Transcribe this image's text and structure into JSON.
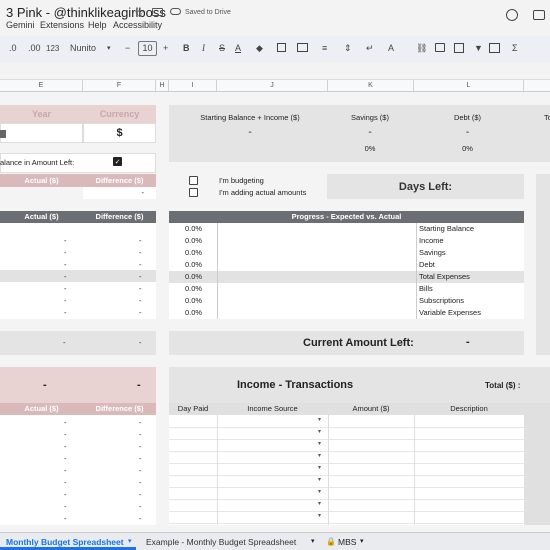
{
  "window": {
    "doc_title": "3 Pink - @thinklikeagirlboss",
    "saved_status": "Saved to Drive",
    "menu": [
      "Gemini",
      "Extensions",
      "Help",
      "Accessibility"
    ]
  },
  "toolbar": {
    "decimal_decrease": ".0",
    "decimal_increase": ".00",
    "number_format": "123",
    "font": "Nunito",
    "font_size": "10",
    "minus": "−",
    "plus": "+",
    "bold": "B",
    "italic": "I",
    "strike": "S",
    "text_color": "A",
    "sum": "Σ"
  },
  "columns": [
    "E",
    "F",
    "H",
    "I",
    "J",
    "K",
    "L"
  ],
  "left": {
    "year_label": "Year",
    "currency_label": "Currency",
    "currency_value": "$",
    "balance_label": "alance in Amount Left:",
    "actual_label": "Actual ($)",
    "difference_label": "Difference ($)",
    "dash": "-",
    "top_dash": "-"
  },
  "summary": {
    "starting_label": "Starting Balance + Income ($)",
    "savings_label": "Savings ($)",
    "debt_label": "Debt ($)",
    "extra_label": "To",
    "starting_value": "-",
    "savings_value": "-",
    "debt_value": "-",
    "savings_pct": "0%",
    "debt_pct": "0%"
  },
  "checks": {
    "budgeting": "I'm budgeting",
    "actual": "I'm adding actual amounts",
    "days_left": "Days Left:"
  },
  "progress": {
    "title": "Progress - Expected vs. Actual",
    "rows": [
      {
        "pct": "0.0%",
        "label": "Starting Balance"
      },
      {
        "pct": "0.0%",
        "label": "Income"
      },
      {
        "pct": "0.0%",
        "label": "Savings"
      },
      {
        "pct": "0.0%",
        "label": "Debt"
      },
      {
        "pct": "0.0%",
        "label": "Total Expenses"
      },
      {
        "pct": "0.0%",
        "label": "Bills"
      },
      {
        "pct": "0.0%",
        "label": "Subscriptions"
      },
      {
        "pct": "0.0%",
        "label": "Variable Expenses"
      }
    ]
  },
  "current": {
    "label": "Current Amount Left:",
    "value": "-"
  },
  "income": {
    "title": "Income - Transactions",
    "total_label": "Total ($) :",
    "headers": [
      "Day Paid",
      "Income Source",
      "Amount ($)",
      "Description"
    ]
  },
  "tabs": {
    "active": "Monthly Budget Spreadsheet",
    "example": "Example - Monthly Budget Spreadsheet",
    "mbs": "MBS"
  },
  "colors": {
    "pink": "#d9b9b9",
    "dark_header": "#6b6f74",
    "active_tab": "#1a73e8"
  }
}
